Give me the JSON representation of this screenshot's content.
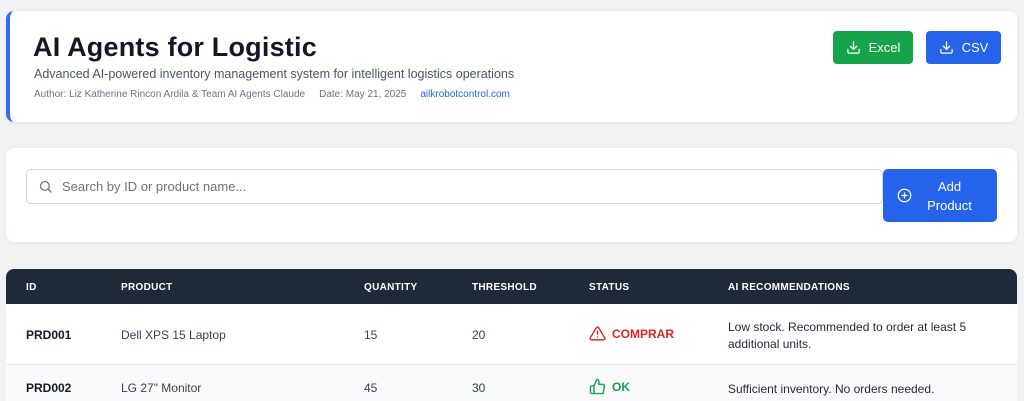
{
  "header": {
    "title": "AI Agents for Logistic",
    "subtitle": "Advanced AI-powered inventory management system for intelligent logistics operations",
    "author": "Author: Liz Katherine Rincon Ardila & Team AI Agents Claude",
    "date": "Date: May 21, 2025",
    "site": "ailkrobotcontrol.com",
    "accent_color": "#2f6fe4"
  },
  "export": {
    "excel_label": "Excel",
    "excel_icon": "download-icon",
    "excel_color": "#16a34a",
    "csv_label": "CSV",
    "csv_icon": "download-icon",
    "csv_color": "#2563eb"
  },
  "search": {
    "placeholder": "Search by ID or product name...",
    "value": "",
    "icon": "search-icon",
    "add_label": "Add\nProduct",
    "add_icon": "plus-circle-icon"
  },
  "table": {
    "columns": [
      "ID",
      "PRODUCT",
      "QUANTITY",
      "THRESHOLD",
      "STATUS",
      "AI RECOMMENDATIONS"
    ],
    "rows": [
      {
        "id": "PRD001",
        "product": "Dell XPS 15 Laptop",
        "quantity": "15",
        "threshold": "20",
        "status": "COMPRAR",
        "status_icon": "warning-triangle-icon",
        "status_color": "#dc2626",
        "recommendation": "Low stock. Recommended to order at least 5 additional units."
      },
      {
        "id": "PRD002",
        "product": "LG 27\" Monitor",
        "quantity": "45",
        "threshold": "30",
        "status": "OK",
        "status_icon": "thumbs-up-icon",
        "status_color": "#16a34a",
        "recommendation": "Sufficient inventory. No orders needed."
      }
    ]
  }
}
